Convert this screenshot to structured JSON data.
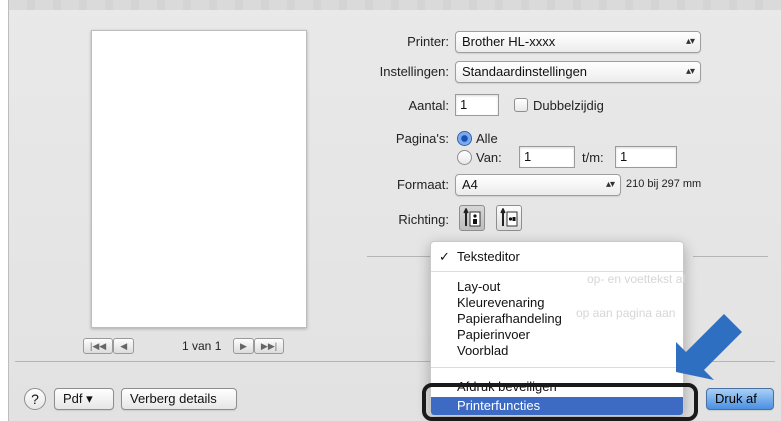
{
  "printer": {
    "label": "Printer:",
    "value": "Brother HL-xxxx"
  },
  "presets": {
    "label": "Instellingen:",
    "value": "Standaardinstellingen"
  },
  "copies": {
    "label": "Aantal:",
    "value": "1",
    "two_sided_label": "Dubbelzijdig"
  },
  "pages": {
    "label": "Pagina's:",
    "all_label": "Alle",
    "range_label": "Van:",
    "from_value": "1",
    "to_label": "t/m:",
    "to_value": "1"
  },
  "paper_size": {
    "label": "Formaat:",
    "value": "A4",
    "dimensions": "210 bij 297 mm"
  },
  "orientation": {
    "label": "Richting:"
  },
  "preview": {
    "page_label": "1 van 1"
  },
  "menu": {
    "checked": "Teksteditor",
    "items": [
      "Lay-out",
      "Kleurevenaring",
      "Papierafhandeling",
      "Papierinvoer",
      "Voorblad"
    ],
    "partial": "Afdruk beveiligen",
    "selected": "Printerfuncties"
  },
  "ghost_text": {
    "line1": "op- en voettekst af",
    "line2": "op aan pagina aan"
  },
  "bottom": {
    "help_label": "?",
    "pdf_label": "Pdf ▾",
    "hide_details_label": "Verberg details",
    "print_label": "Druk af"
  },
  "colors": {
    "menu_selection": "#3d6bc4",
    "pointer_arrow": "#2f6fc2",
    "highlight_border": "#1a1a1a"
  }
}
